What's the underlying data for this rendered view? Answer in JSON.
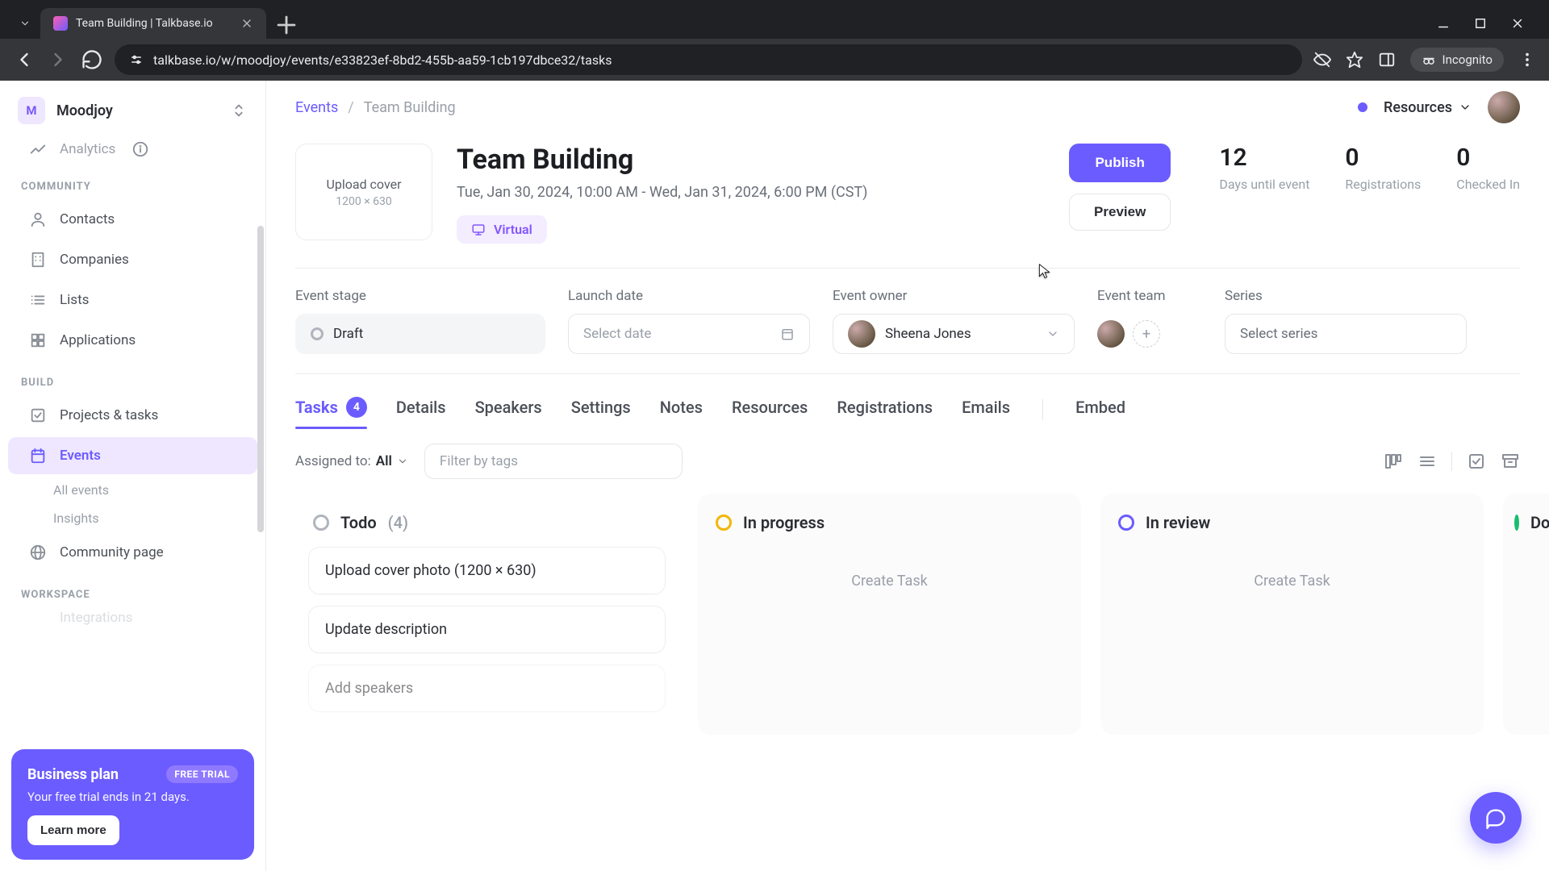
{
  "browser": {
    "tab_title": "Team Building | Talkbase.io",
    "url": "talkbase.io/w/moodjoy/events/e33823ef-8bd2-455b-aa59-1cb197dbce32/tasks",
    "incognito_label": "Incognito"
  },
  "workspace": {
    "initial": "M",
    "name": "Moodjoy"
  },
  "sidebar": {
    "analytics_peek": "Analytics",
    "sections": {
      "community": "COMMUNITY",
      "build": "BUILD",
      "workspace": "WORKSPACE"
    },
    "items": {
      "contacts": "Contacts",
      "companies": "Companies",
      "lists": "Lists",
      "applications": "Applications",
      "projects": "Projects & tasks",
      "events": "Events",
      "events_all": "All events",
      "events_insights": "Insights",
      "community_page": "Community page",
      "integrations_peek": "Integrations"
    }
  },
  "promo": {
    "title": "Business plan",
    "badge": "FREE TRIAL",
    "subtitle": "Your free trial ends in 21 days.",
    "button": "Learn more"
  },
  "topbar": {
    "crumb_root": "Events",
    "crumb_current": "Team Building",
    "resources": "Resources"
  },
  "event": {
    "title": "Team Building",
    "dates": "Tue, Jan 30, 2024, 10:00 AM - Wed, Jan 31, 2024, 6:00 PM (CST)",
    "chip": "Virtual",
    "cover_line1": "Upload cover",
    "cover_line2": "1200 × 630",
    "publish": "Publish",
    "preview": "Preview",
    "stats": {
      "days_n": "12",
      "days_l": "Days until event",
      "reg_n": "0",
      "reg_l": "Registrations",
      "chk_n": "0",
      "chk_l": "Checked In"
    }
  },
  "meta": {
    "stage_label": "Event stage",
    "stage_value": "Draft",
    "launch_label": "Launch date",
    "launch_placeholder": "Select date",
    "owner_label": "Event owner",
    "owner_value": "Sheena Jones",
    "team_label": "Event team",
    "series_label": "Series",
    "series_placeholder": "Select series"
  },
  "tabs": {
    "tasks": "Tasks",
    "tasks_count": "4",
    "details": "Details",
    "speakers": "Speakers",
    "settings": "Settings",
    "notes": "Notes",
    "resources": "Resources",
    "registrations": "Registrations",
    "emails": "Emails",
    "embed": "Embed"
  },
  "filters": {
    "assigned_label": "Assigned to:",
    "assigned_value": "All",
    "tag_placeholder": "Filter by tags"
  },
  "board": {
    "todo": {
      "title": "Todo",
      "count": "(4)",
      "cards": [
        "Upload cover photo (1200 × 630)",
        "Update description",
        "Add speakers"
      ]
    },
    "in_progress": {
      "title": "In progress",
      "create": "Create Task"
    },
    "in_review": {
      "title": "In review",
      "create": "Create Task"
    },
    "done_peek": "Do"
  }
}
